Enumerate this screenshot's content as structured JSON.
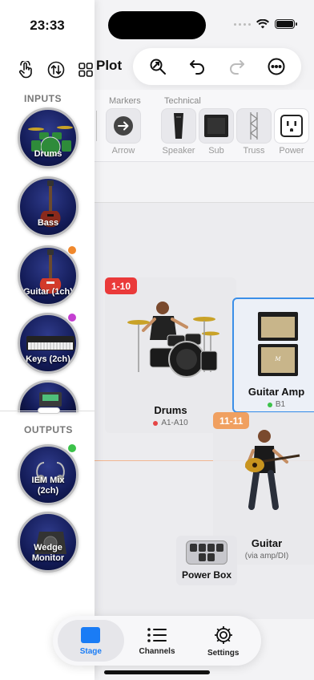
{
  "status": {
    "time": "23:33"
  },
  "header": {
    "title": "Plot"
  },
  "toolbar": {
    "zoom": "zoom-icon",
    "undo": "undo-icon",
    "redo": "redo-icon",
    "more": "more-icon"
  },
  "sidebar": {
    "inputs_label": "INPUTS",
    "outputs_label": "OUTPUTS",
    "inputs": [
      {
        "label": "Drums",
        "status": ""
      },
      {
        "label": "Bass",
        "status": ""
      },
      {
        "label": "Guitar (1ch)",
        "status": "#f0882c"
      },
      {
        "label": "Keys (2ch)",
        "status": "#c43fd1"
      },
      {
        "label": "",
        "status": ""
      }
    ],
    "outputs": [
      {
        "label": "IEM Mix (2ch)",
        "status": "#3cc24a"
      },
      {
        "label": "Wedge Monitor",
        "status": ""
      }
    ]
  },
  "tray": {
    "categories": {
      "markers": "Markers",
      "technical": "Technical"
    },
    "items": [
      {
        "label": "Arrow"
      },
      {
        "label": "Speaker"
      },
      {
        "label": "Sub"
      },
      {
        "label": "Truss"
      },
      {
        "label": "Power"
      }
    ]
  },
  "stage": {
    "drums": {
      "badge": "1-10",
      "name": "Drums",
      "channels": "A1-A10",
      "badge_color": "#ea3a3a",
      "dot_color": "#e54545"
    },
    "guitar_amp": {
      "name": "Guitar Amp",
      "channels": "B1",
      "dot_color": "#3cc24a"
    },
    "guitar": {
      "badge": "11-11",
      "name": "Guitar",
      "sub": "(via amp/DI)",
      "badge_color": "#f0a060"
    },
    "power_box": {
      "name": "Power Box"
    }
  },
  "tabs": [
    {
      "label": "Stage",
      "active": true
    },
    {
      "label": "Channels",
      "active": false
    },
    {
      "label": "Settings",
      "active": false
    }
  ],
  "colors": {
    "accent": "#1a7cf5",
    "amp_border": "#3b8fe8"
  }
}
